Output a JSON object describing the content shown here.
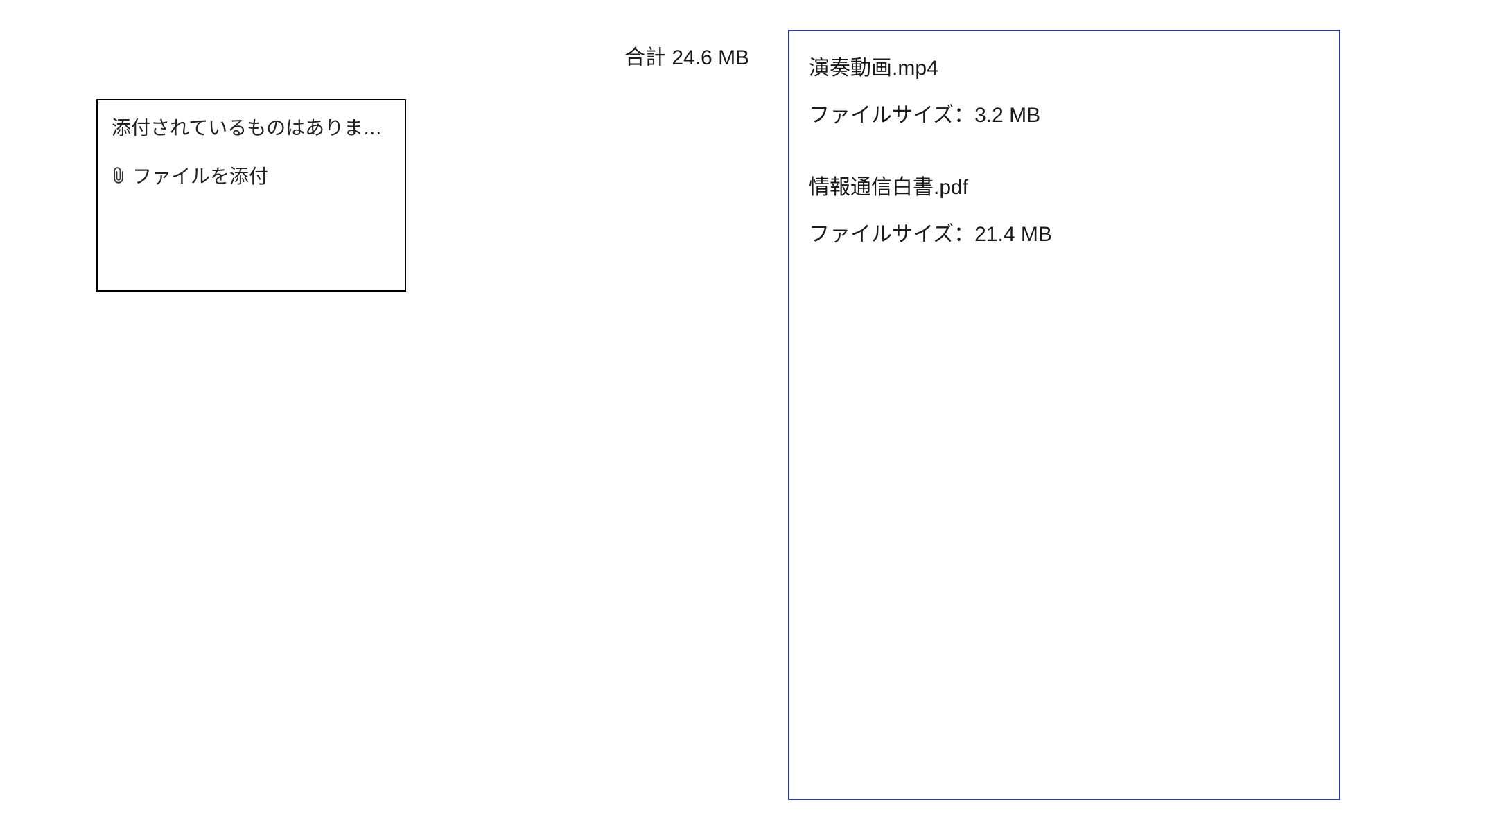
{
  "attachment_panel": {
    "empty_text": "添付されているものはありませ…",
    "attach_button_label": "ファイルを添付"
  },
  "total": {
    "label_prefix": "合計 ",
    "value": "24.6 MB"
  },
  "size_field_label": "ファイルサイズ：",
  "files": [
    {
      "name": "演奏動画.mp4",
      "size": "3.2 MB"
    },
    {
      "name": "情報通信白書.pdf",
      "size": "21.4 MB"
    }
  ],
  "colors": {
    "outline_black": "#000000",
    "outline_navy": "#2a3a9a"
  }
}
